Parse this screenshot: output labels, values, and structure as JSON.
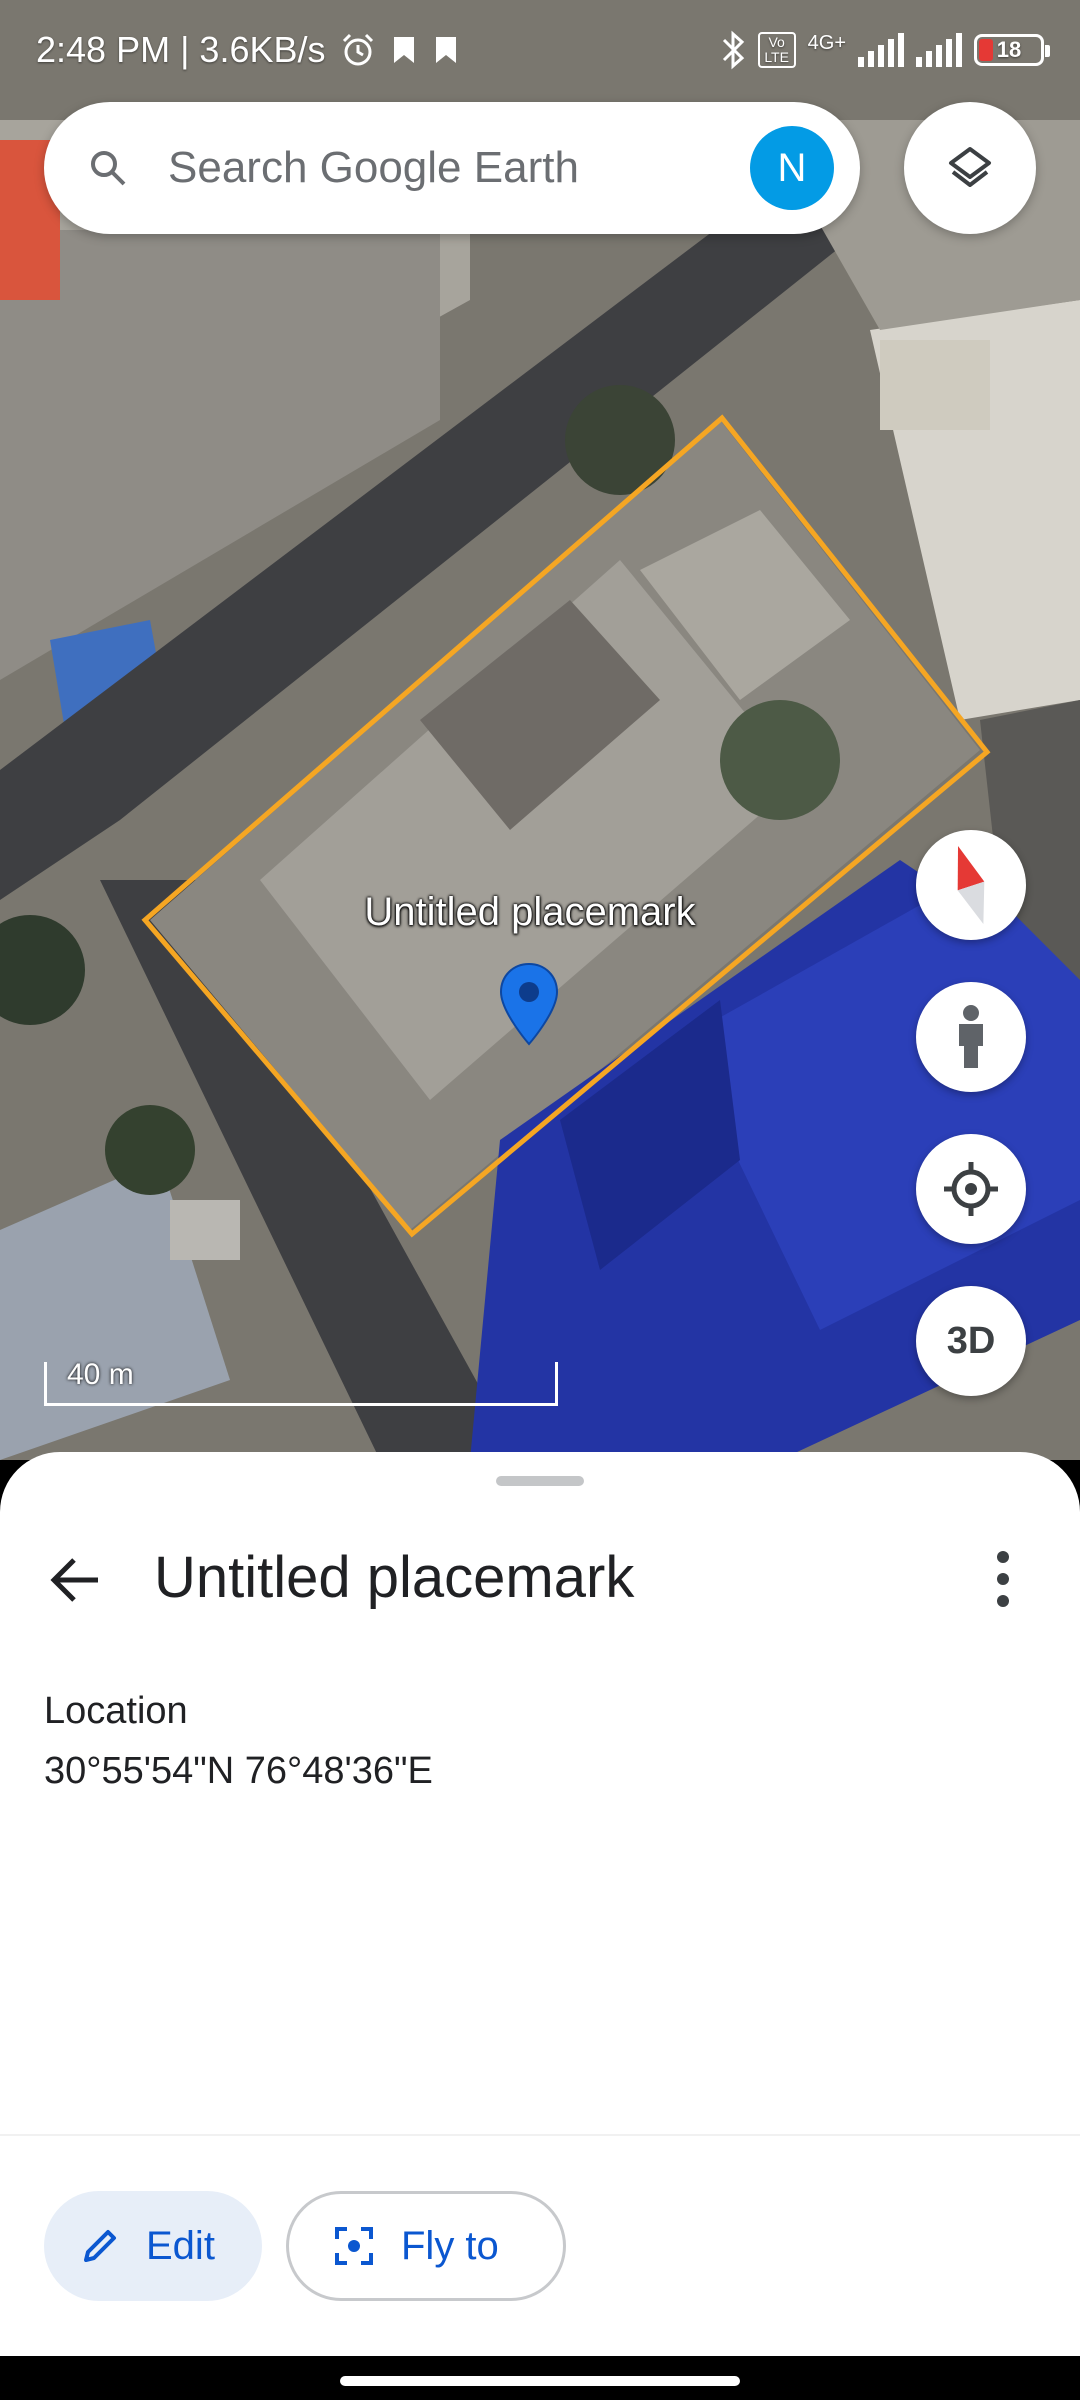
{
  "status_bar": {
    "time_speed": "2:48 PM | 3.6KB/s",
    "network": "4G+",
    "volte": "Vo LTE",
    "battery": "18"
  },
  "search": {
    "placeholder": "Search Google Earth",
    "avatar_letter": "N"
  },
  "map": {
    "placemark_label": "Untitled placemark",
    "scale_label": "40 m",
    "view_mode_button": "3D",
    "polygon_color": "#f5a623",
    "pin_color": "#1a73e8"
  },
  "sheet": {
    "title": "Untitled placemark",
    "location_label": "Location",
    "location_value": "30°55'54\"N 76°48'36\"E",
    "edit_label": "Edit",
    "flyto_label": "Fly to"
  },
  "colors": {
    "accent": "#0b57d0",
    "avatar_bg": "#039be5",
    "edit_bg": "#e7eef8"
  }
}
